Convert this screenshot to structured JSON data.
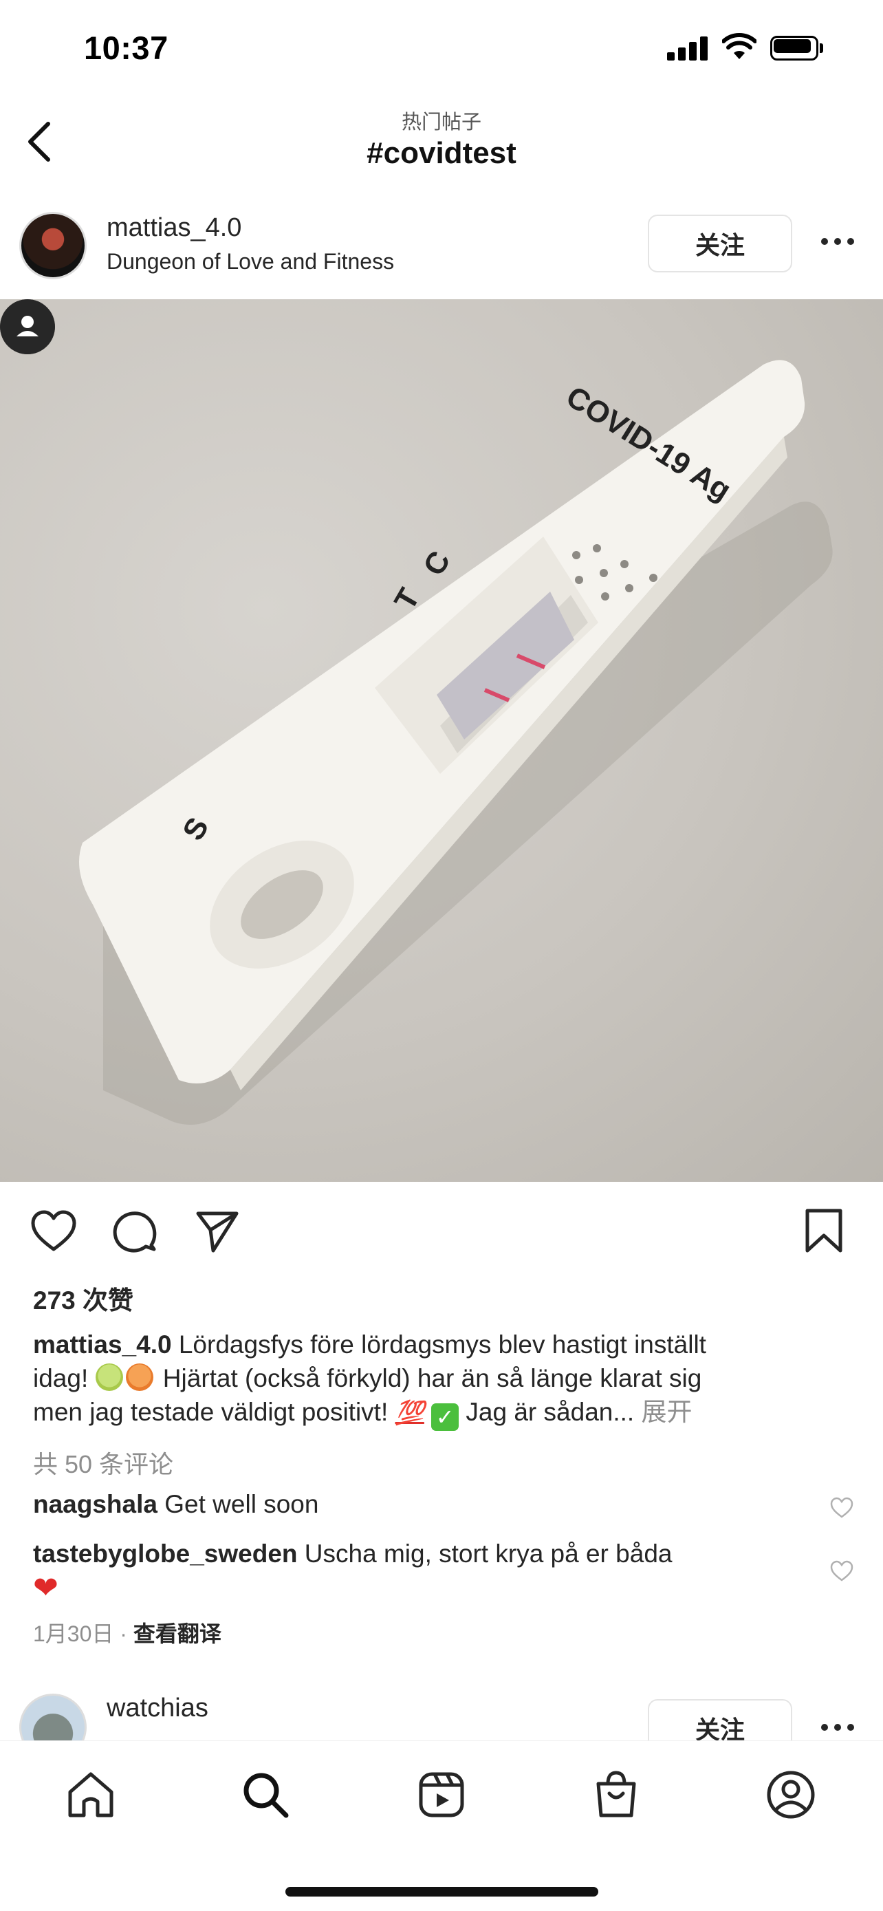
{
  "status_bar": {
    "time": "10:37"
  },
  "header": {
    "subtitle": "热门帖子",
    "title": "#covidtest"
  },
  "post": {
    "username": "mattias_4.0",
    "subline": "Dungeon of Love and Fitness",
    "follow_label": "关注",
    "photo_text": {
      "brand": "COVID-19 Ag",
      "c": "C",
      "t": "T",
      "s": "S"
    },
    "likes": "273 次赞",
    "caption": {
      "username": "mattias_4.0",
      "line1": " Lördagsfys före lördagsmys blev hastigt inställt",
      "line2_start": "idag! ",
      "line2_end": " Hjärtat (också förkyld) har än så länge klarat sig",
      "line3_start": "men jag testade väldigt positivt! ",
      "emoji_100": "💯",
      "emoji_check": "✓",
      "line3_end": " Jag är sådan...",
      "more": " 展开"
    },
    "comments_count": "共 50 条评论",
    "comments": [
      {
        "username": "naagshala",
        "text": " Get well soon"
      },
      {
        "username": "tastebyglobe_sweden",
        "text": " Uscha mig, stort krya på er båda",
        "emoji": "❤"
      }
    ],
    "date": "1月30日",
    "separator": " · ",
    "translate": "查看翻译"
  },
  "next_post": {
    "username": "watchias",
    "follow_label": "关注"
  },
  "tabbar": {
    "items": [
      "home-icon",
      "search-icon",
      "reels-icon",
      "shop-icon",
      "profile-icon"
    ]
  }
}
